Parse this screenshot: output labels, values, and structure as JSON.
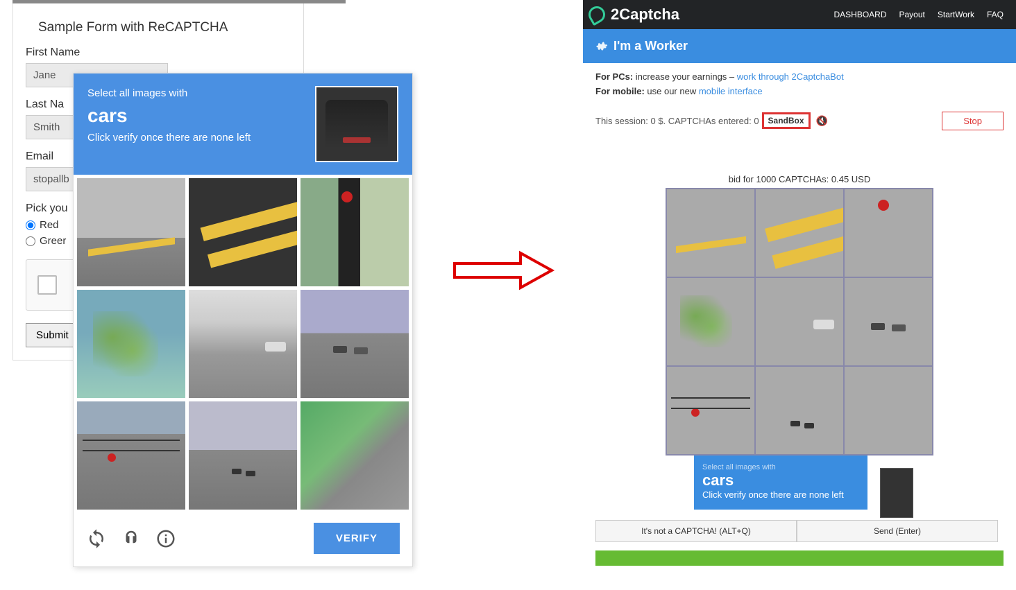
{
  "form": {
    "title": "Sample Form with ReCAPTCHA",
    "first_name_label": "First Name",
    "first_name_value": "Jane",
    "last_name_label": "Last Na",
    "last_name_value": "Smith",
    "email_label": "Email",
    "email_value": "stopallb",
    "color_label": "Pick you",
    "red_label": "Red",
    "green_label": "Greer",
    "submit_label": "Submit"
  },
  "captcha": {
    "prompt_line1": "Select all images with",
    "target": "cars",
    "prompt_line2": "Click verify once there are none left",
    "verify_label": "VERIFY"
  },
  "right": {
    "brand": "2Captcha",
    "nav": {
      "dashboard": "DASHBOARD",
      "payout": "Payout",
      "startwork": "StartWork",
      "faq": "FAQ"
    },
    "worker_heading": "I'm a Worker",
    "tip_pc_prefix": "For PCs:",
    "tip_pc_text": " increase your earnings – ",
    "tip_pc_link": "work through 2CaptchaBot",
    "tip_mobile_prefix": "For mobile:",
    "tip_mobile_text": " use our new ",
    "tip_mobile_link": "mobile interface",
    "session_text": "This session: 0 $. CAPTCHAs entered: 0",
    "sandbox": "SandBox",
    "stop": "Stop",
    "bid": "bid for 1000 CAPTCHAs: 0.45 USD",
    "instr_top": "Select all images with",
    "instr_target": "cars",
    "instr_sub": "Click verify once there are none left",
    "not_captcha": "It's not a CAPTCHA! (ALT+Q)",
    "send": "Send (Enter)"
  }
}
